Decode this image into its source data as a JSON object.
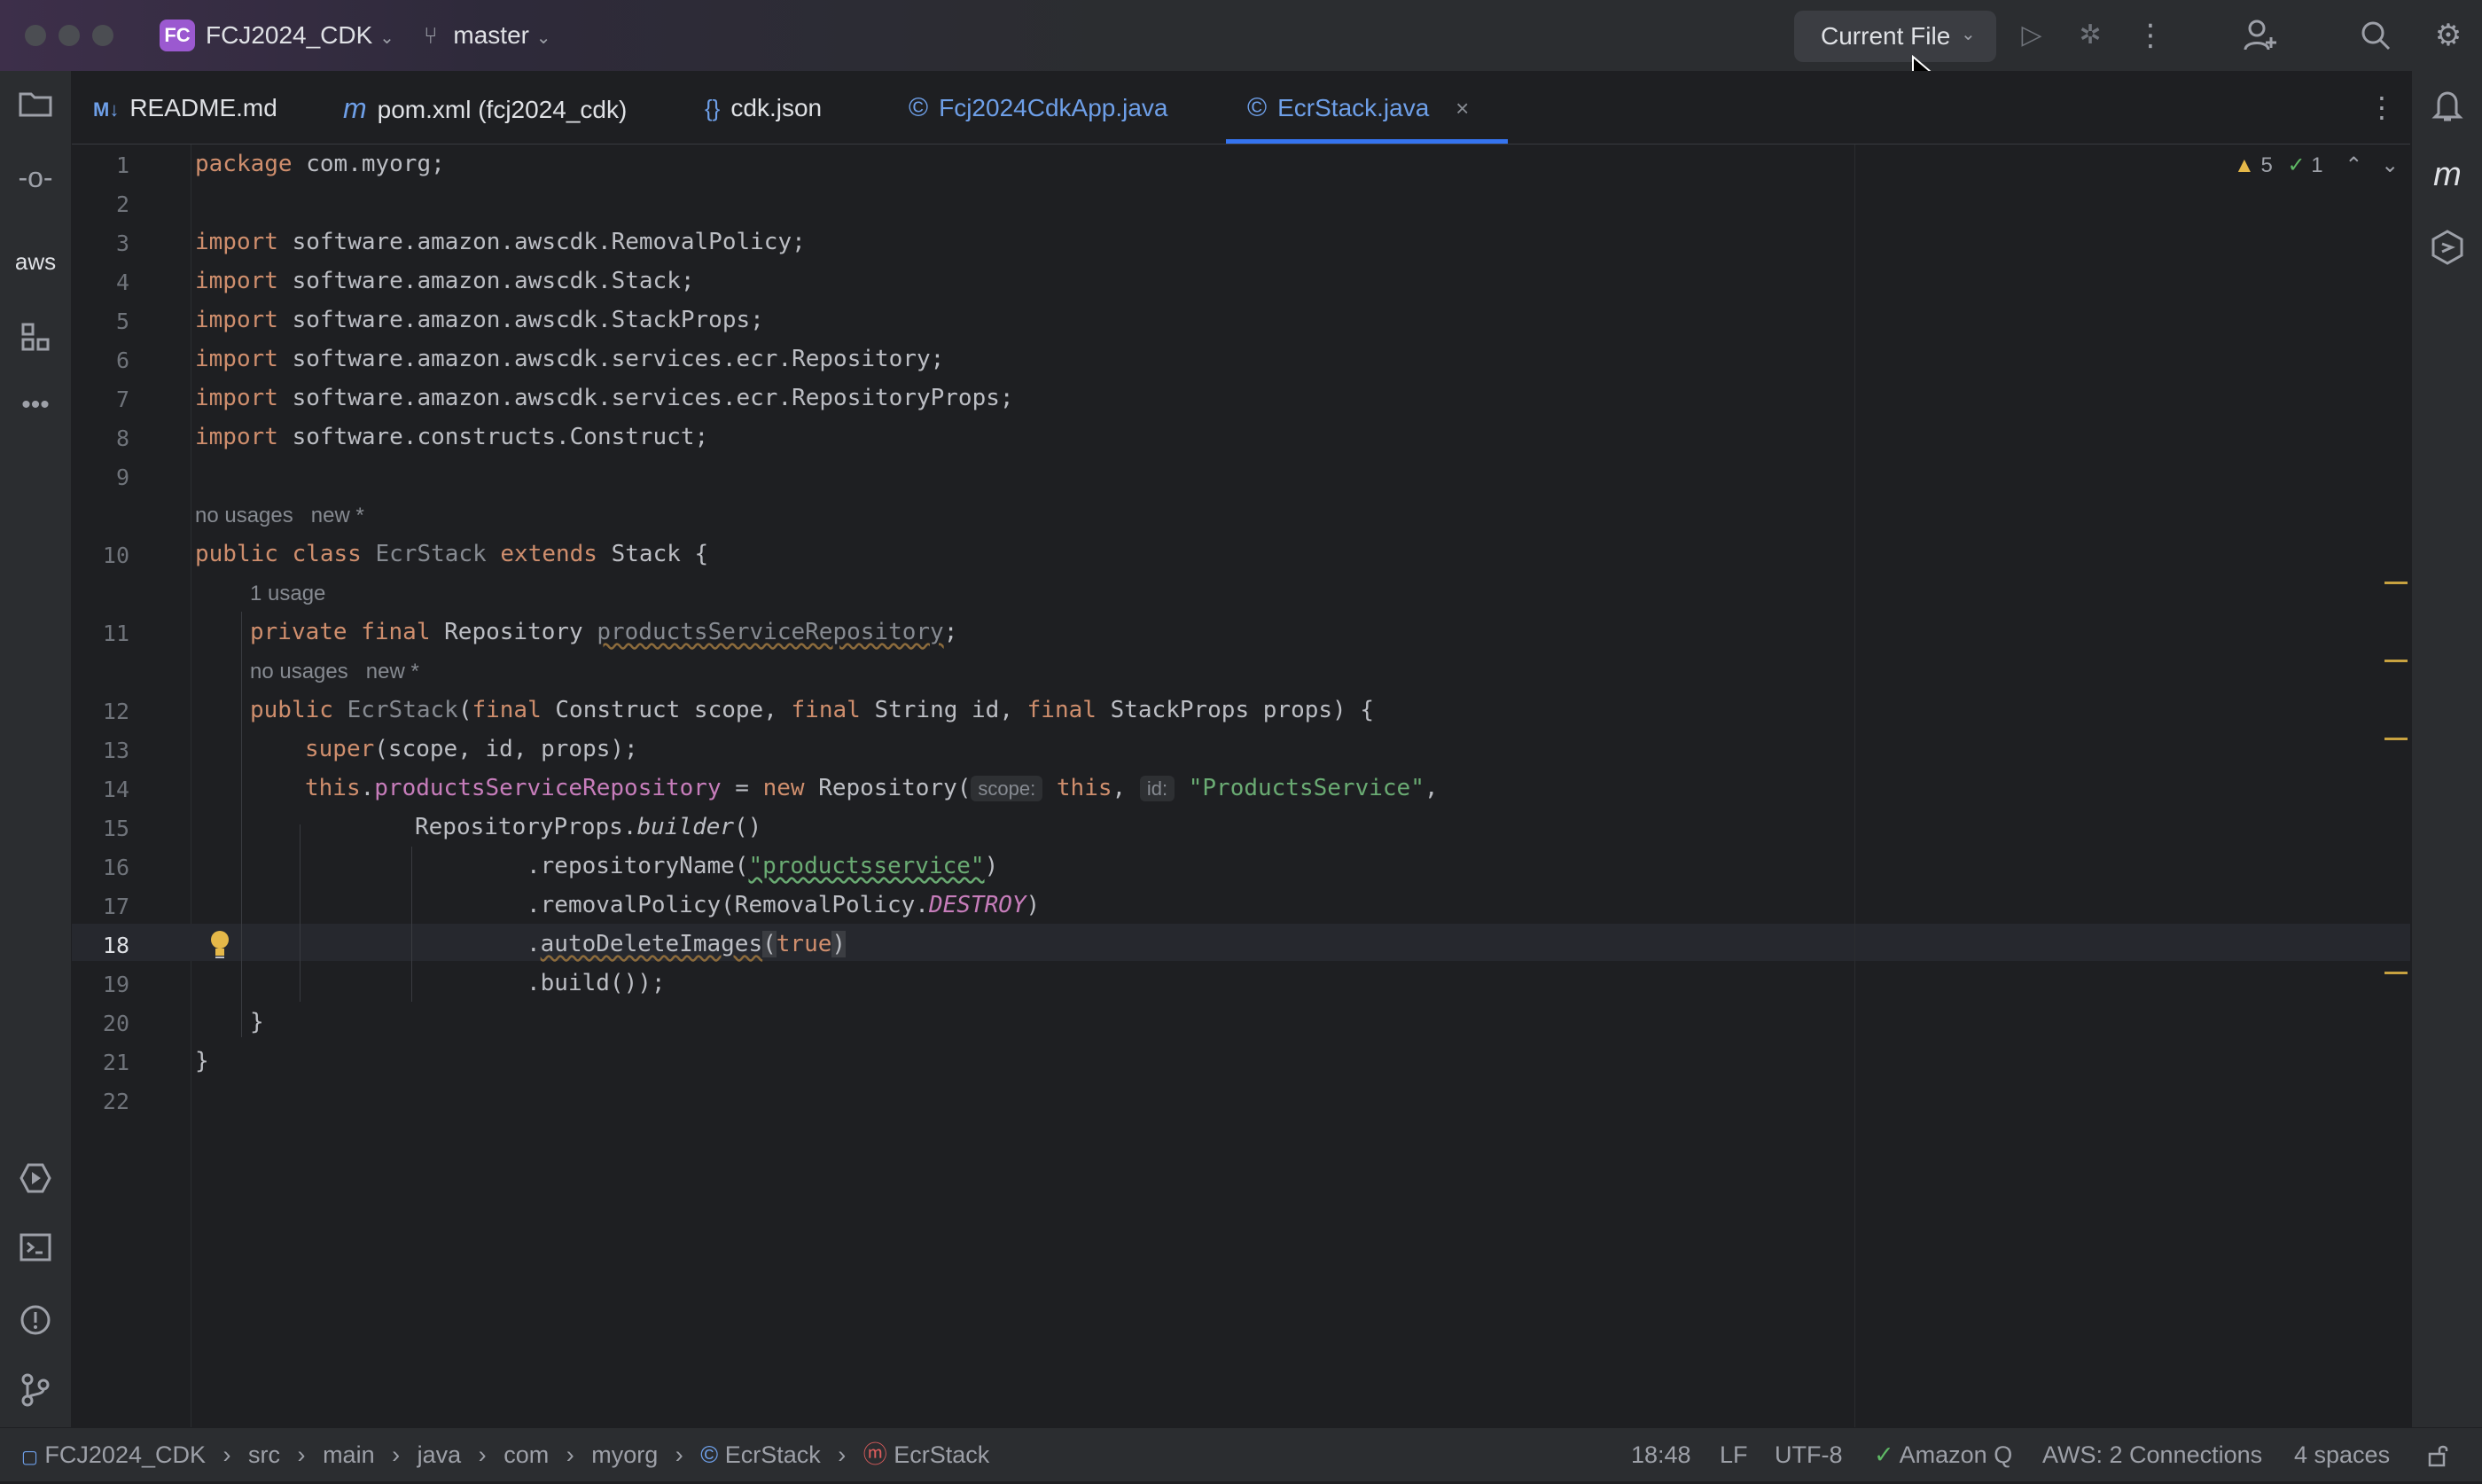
{
  "titlebar": {
    "project_badge": "FC",
    "project_name": "FCJ2024_CDK",
    "branch": "master",
    "run_config": "Current File"
  },
  "tabs": [
    {
      "icon": "M↓",
      "label": "README.md"
    },
    {
      "icon": "m",
      "label": "pom.xml (fcj2024_cdk)"
    },
    {
      "icon": "{}",
      "label": "cdk.json"
    },
    {
      "icon": "©",
      "label": "Fcj2024CdkApp.java"
    },
    {
      "icon": "©",
      "label": "EcrStack.java",
      "active": true
    }
  ],
  "left_tools": {
    "aws_label": "aws"
  },
  "inspections": {
    "warnings": "5",
    "ok": "1"
  },
  "hints": {
    "h1": "no usages   new *",
    "h2": "1 usage",
    "h3": "no usages   new *"
  },
  "inlay": {
    "scope": "scope:",
    "id": "id:"
  },
  "line_numbers": [
    "1",
    "2",
    "3",
    "4",
    "5",
    "6",
    "7",
    "8",
    "9",
    "10",
    "11",
    "12",
    "13",
    "14",
    "15",
    "16",
    "17",
    "18",
    "19",
    "20",
    "21",
    "22"
  ],
  "code": {
    "l1_kw": "package",
    "l1_rest": " com.myorg;",
    "l3_kw": "import",
    "l3_rest": " software.amazon.awscdk.RemovalPolicy;",
    "l4_kw": "import",
    "l4_rest": " software.amazon.awscdk.Stack;",
    "l5_kw": "import",
    "l5_rest": " software.amazon.awscdk.StackProps;",
    "l6_kw": "import",
    "l6_rest": " software.amazon.awscdk.services.ecr.Repository;",
    "l7_kw": "import",
    "l7_rest": " software.amazon.awscdk.services.ecr.RepositoryProps;",
    "l8_kw": "import",
    "l8_rest": " software.constructs.Construct;",
    "l10_a": "public class",
    "l10_b": " EcrStack ",
    "l10_c": "extends",
    "l10_d": " Stack {",
    "l11_a": "private final",
    "l11_b": " Repository ",
    "l11_c": "productsServiceRepository",
    "l11_d": ";",
    "l12_a": "public",
    "l12_b": " EcrStack",
    "l12_c": "(",
    "l12_d": "final",
    "l12_e": " Construct scope, ",
    "l12_f": "final",
    "l12_g": " String id, ",
    "l12_h": "final",
    "l12_i": " StackProps props) {",
    "l13_a": "super",
    "l13_b": "(scope, id, props);",
    "l14_a": "this",
    "l14_b": ".",
    "l14_c": "productsServiceRepository",
    "l14_d": " = ",
    "l14_e": "new",
    "l14_f": " Repository(",
    "l14_g": "this",
    "l14_h": ",",
    "l14_i": "\"ProductsService\"",
    "l14_j": ",",
    "l15_a": "RepositoryProps.",
    "l15_b": "builder",
    "l15_c": "()",
    "l16_a": ".repositoryName(",
    "l16_b": "\"productsservice\"",
    "l16_c": ")",
    "l17_a": ".removalPolicy(RemovalPolicy.",
    "l17_b": "DESTROY",
    "l17_c": ")",
    "l18_a": ".",
    "l18_b": "autoDeleteImages",
    "l18_c": "(",
    "l18_d": "true",
    "l18_e": ")",
    "l19": ".build());",
    "l20": "}",
    "l21": "}"
  },
  "breadcrumb": [
    "FCJ2024_CDK",
    "src",
    "main",
    "java",
    "com",
    "myorg",
    "EcrStack",
    "EcrStack"
  ],
  "status": {
    "position": "18:48",
    "line_sep": "LF",
    "encoding": "UTF-8",
    "amazon_q": "Amazon Q",
    "aws": "AWS: 2 Connections",
    "indent": "4 spaces"
  },
  "colors": {
    "accent": "#3574f0",
    "keyword": "#cf8e6d",
    "string": "#6aab73",
    "field": "#c77dbb"
  }
}
